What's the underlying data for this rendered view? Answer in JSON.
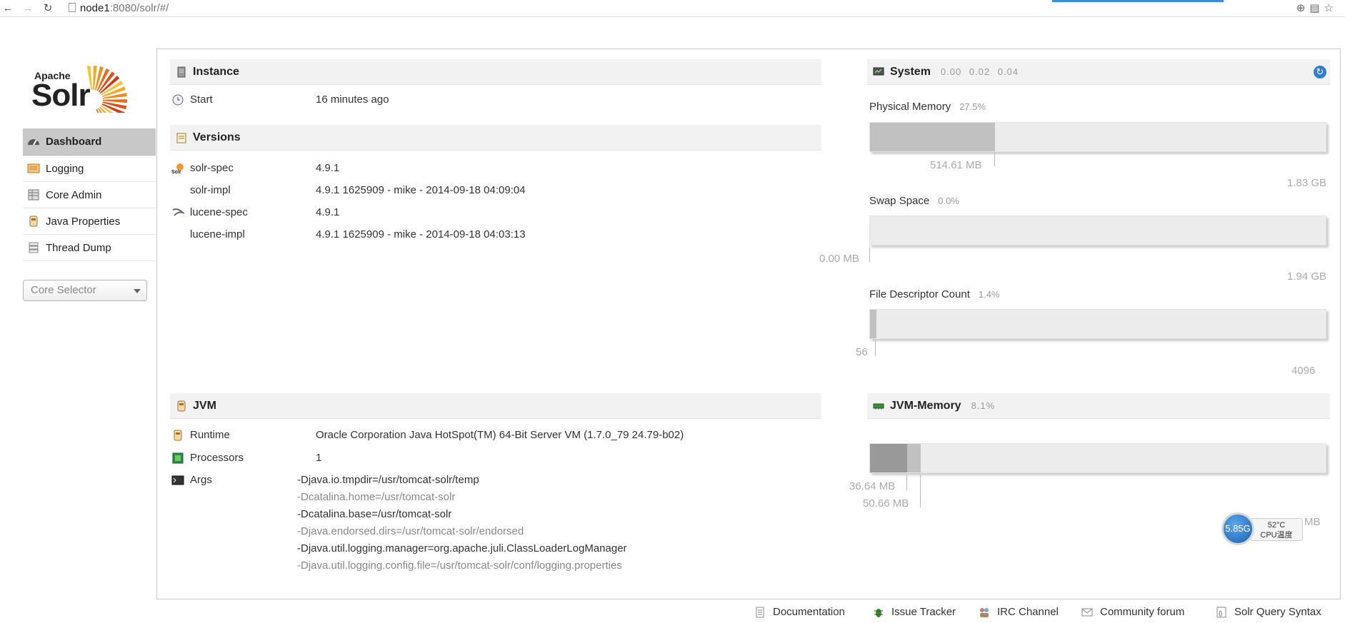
{
  "browser": {
    "url_host": "node1",
    "url_path": ":8080/solr/#/"
  },
  "logo": {
    "apache": "Apache",
    "solr": "Solr"
  },
  "sidebar": {
    "items": [
      {
        "label": "Dashboard",
        "icon": "dashboard-icon",
        "active": true
      },
      {
        "label": "Logging",
        "icon": "logging-icon"
      },
      {
        "label": "Core Admin",
        "icon": "core-admin-icon"
      },
      {
        "label": "Java Properties",
        "icon": "java-properties-icon"
      },
      {
        "label": "Thread Dump",
        "icon": "thread-dump-icon"
      }
    ],
    "core_selector": "Core Selector"
  },
  "instance": {
    "title": "Instance",
    "start_label": "Start",
    "start_value": "16 minutes ago"
  },
  "versions": {
    "title": "Versions",
    "rows": [
      {
        "label": "solr-spec",
        "value": "4.9.1"
      },
      {
        "label": "solr-impl",
        "value": "4.9.1 1625909 - mike - 2014-09-18 04:09:04"
      },
      {
        "label": "lucene-spec",
        "value": "4.9.1"
      },
      {
        "label": "lucene-impl",
        "value": "4.9.1 1625909 - mike - 2014-09-18 04:03:13"
      }
    ]
  },
  "jvm": {
    "title": "JVM",
    "runtime_label": "Runtime",
    "runtime_value": "Oracle Corporation Java HotSpot(TM) 64-Bit Server VM (1.7.0_79 24.79-b02)",
    "processors_label": "Processors",
    "processors_value": "1",
    "args_label": "Args",
    "args": [
      "-Djava.io.tmpdir=/usr/tomcat-solr/temp",
      "-Dcatalina.home=/usr/tomcat-solr",
      "-Dcatalina.base=/usr/tomcat-solr",
      "-Djava.endorsed.dirs=/usr/tomcat-solr/endorsed",
      "-Djava.util.logging.manager=org.apache.juli.ClassLoaderLogManager",
      "-Djava.util.logging.config.file=/usr/tomcat-solr/conf/logging.properties"
    ]
  },
  "system": {
    "title": "System",
    "load": "0.00  0.02  0.04",
    "physical_memory": {
      "title": "Physical Memory",
      "pct": "27.5%",
      "used": "514.61 MB",
      "total": "1.83 GB",
      "fraction": 0.275
    },
    "swap": {
      "title": "Swap Space",
      "pct": "0.0%",
      "used": "0.00 MB",
      "total": "1.94 GB",
      "fraction": 0.0
    },
    "file_descriptors": {
      "title": "File Descriptor Count",
      "pct": "1.4%",
      "used": "56",
      "total": "4096",
      "fraction": 0.014
    }
  },
  "jvm_memory": {
    "title": "JVM-Memory",
    "pct": "8.1%",
    "used": "36.64 MB",
    "committed": "50.66 MB",
    "total_fragment": "MB",
    "used_fraction": 0.081,
    "committed_fraction": 0.112
  },
  "cpu_widget": {
    "freq": "5.85G",
    "temp": "52°C",
    "label": "CPU温度"
  },
  "footer": [
    {
      "label": "Documentation",
      "icon": "documentation-icon"
    },
    {
      "label": "Issue Tracker",
      "icon": "bug-icon"
    },
    {
      "label": "IRC Channel",
      "icon": "irc-icon"
    },
    {
      "label": "Community forum",
      "icon": "mail-icon"
    },
    {
      "label": "Solr Query Syntax",
      "icon": "query-syntax-icon"
    }
  ]
}
